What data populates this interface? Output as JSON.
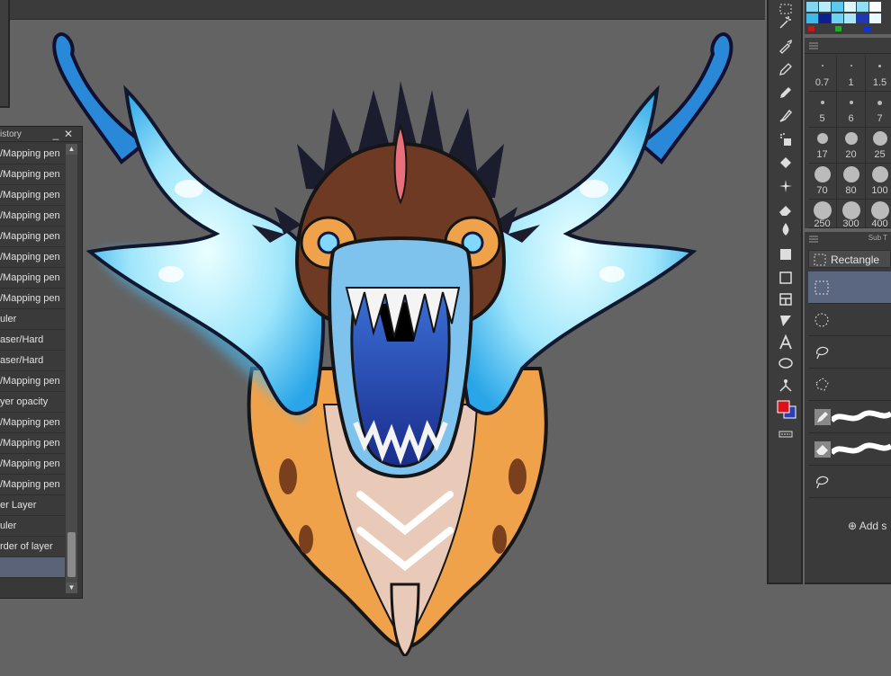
{
  "history": {
    "title": "istory",
    "minimize": "_",
    "close": "✕",
    "items": [
      {
        "label": "/Mapping pen"
      },
      {
        "label": "/Mapping pen"
      },
      {
        "label": "/Mapping pen"
      },
      {
        "label": "/Mapping pen"
      },
      {
        "label": "/Mapping pen"
      },
      {
        "label": "/Mapping pen"
      },
      {
        "label": "/Mapping pen"
      },
      {
        "label": "/Mapping pen"
      },
      {
        "label": "uler"
      },
      {
        "label": "aser/Hard"
      },
      {
        "label": "aser/Hard"
      },
      {
        "label": "/Mapping pen"
      },
      {
        "label": "yer opacity"
      },
      {
        "label": "/Mapping pen"
      },
      {
        "label": "/Mapping pen"
      },
      {
        "label": "/Mapping pen"
      },
      {
        "label": "/Mapping pen"
      },
      {
        "label": "er Layer"
      },
      {
        "label": "uler"
      },
      {
        "label": "rder of layer"
      },
      {
        "label": ""
      }
    ]
  },
  "brushes": [
    {
      "size": "0.7"
    },
    {
      "size": "1"
    },
    {
      "size": "1.5"
    },
    {
      "size": "5"
    },
    {
      "size": "6"
    },
    {
      "size": "7"
    },
    {
      "size": "17"
    },
    {
      "size": "20"
    },
    {
      "size": "25"
    },
    {
      "size": "70"
    },
    {
      "size": "80"
    },
    {
      "size": "100"
    },
    {
      "size": "250"
    },
    {
      "size": "300"
    },
    {
      "size": "400"
    }
  ],
  "subtool": {
    "title": "Sub T",
    "current": "Rectangle",
    "add_label": "Add s"
  },
  "colors": {
    "main": "#e01018",
    "sub": "#2a3fb5"
  }
}
